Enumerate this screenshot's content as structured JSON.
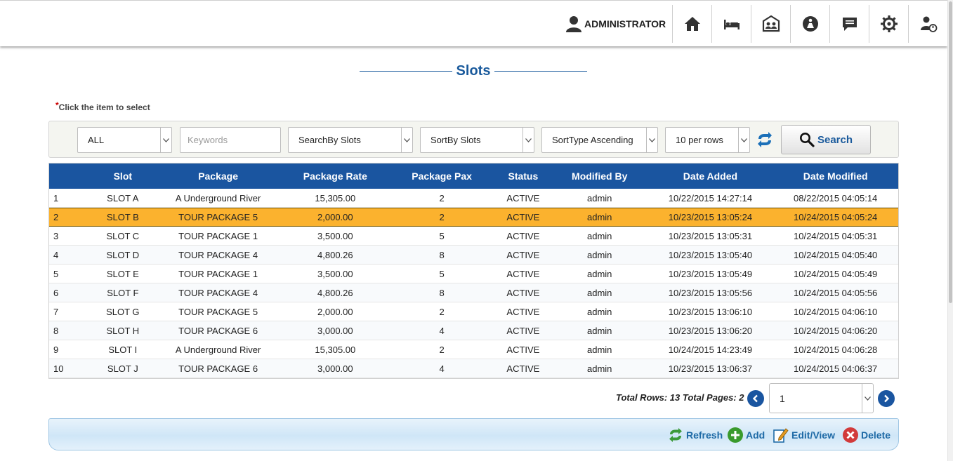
{
  "header": {
    "user_name": "ADMINISTRATOR",
    "nav_icons": [
      "home-icon",
      "bed-icon",
      "guest-card-icon",
      "tour-icon",
      "message-icon",
      "settings-icon",
      "user-logout-icon"
    ]
  },
  "page": {
    "title": "Slots",
    "hint_marker": "*",
    "hint": "Click the item to select"
  },
  "filters": {
    "status_value": "ALL",
    "keywords_placeholder": "Keywords",
    "search_by_value": "SearchBy Slots",
    "sort_by_value": "SortBy Slots",
    "sort_type_value": "SortType Ascending",
    "per_page_value": "10 per rows",
    "search_label": "Search"
  },
  "table": {
    "columns": [
      "",
      "Slot",
      "Package",
      "Package Rate",
      "Package Pax",
      "Status",
      "Modified By",
      "Date Added",
      "Date Modified"
    ],
    "rows": [
      [
        "1",
        "SLOT A",
        "A Underground River",
        "15,305.00",
        "2",
        "ACTIVE",
        "admin",
        "10/22/2015 14:27:14",
        "08/22/2015 04:05:14"
      ],
      [
        "2",
        "SLOT B",
        "TOUR PACKAGE 5",
        "2,000.00",
        "2",
        "ACTIVE",
        "admin",
        "10/23/2015 13:05:24",
        "10/24/2015 04:05:24"
      ],
      [
        "3",
        "SLOT C",
        "TOUR PACKAGE 1",
        "3,500.00",
        "5",
        "ACTIVE",
        "admin",
        "10/23/2015 13:05:31",
        "10/24/2015 04:05:31"
      ],
      [
        "4",
        "SLOT D",
        "TOUR PACKAGE 4",
        "4,800.26",
        "8",
        "ACTIVE",
        "admin",
        "10/23/2015 13:05:40",
        "10/24/2015 04:05:40"
      ],
      [
        "5",
        "SLOT E",
        "TOUR PACKAGE 1",
        "3,500.00",
        "5",
        "ACTIVE",
        "admin",
        "10/23/2015 13:05:49",
        "10/24/2015 04:05:49"
      ],
      [
        "6",
        "SLOT F",
        "TOUR PACKAGE 4",
        "4,800.26",
        "8",
        "ACTIVE",
        "admin",
        "10/23/2015 13:05:56",
        "10/24/2015 04:05:56"
      ],
      [
        "7",
        "SLOT G",
        "TOUR PACKAGE 5",
        "2,000.00",
        "2",
        "ACTIVE",
        "admin",
        "10/23/2015 13:06:10",
        "10/24/2015 04:06:10"
      ],
      [
        "8",
        "SLOT H",
        "TOUR PACKAGE 6",
        "3,000.00",
        "4",
        "ACTIVE",
        "admin",
        "10/23/2015 13:06:20",
        "10/24/2015 04:06:20"
      ],
      [
        "9",
        "SLOT I",
        "A Underground River",
        "15,305.00",
        "2",
        "ACTIVE",
        "admin",
        "10/24/2015 14:23:49",
        "10/24/2015 04:06:28"
      ],
      [
        "10",
        "SLOT J",
        "TOUR PACKAGE 6",
        "3,000.00",
        "4",
        "ACTIVE",
        "admin",
        "10/23/2015 13:06:37",
        "10/24/2015 04:06:37"
      ]
    ],
    "selected_row": 1,
    "selected_color": "#fbb22e",
    "header_color": "#1a55a0"
  },
  "pager": {
    "summary": "Total Rows: 13 Total Pages: 2",
    "current_page": "1"
  },
  "actions": {
    "refresh": "Refresh",
    "add": "Add",
    "edit_view": "Edit/View",
    "delete": "Delete"
  }
}
